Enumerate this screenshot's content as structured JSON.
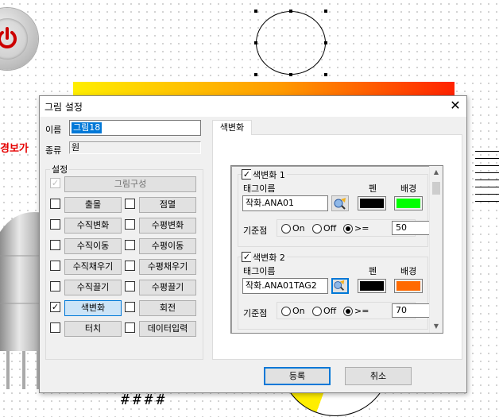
{
  "canvas": {
    "alarm_text": "경보가",
    "hash_text": "####"
  },
  "dialog": {
    "title": "그림 설정",
    "close_symbol": "✕",
    "name_label": "이름",
    "name_value": "그림18",
    "type_label": "종류",
    "type_value": "원",
    "settings_group_label": "설정",
    "settings": {
      "shape_config": "그림구성",
      "appear": "출몰",
      "blink": "점멸",
      "vertical_change": "수직변화",
      "horizontal_change": "수평변화",
      "vertical_move": "수직이동",
      "horizontal_move": "수평이동",
      "vertical_fill": "수직채우기",
      "horizontal_fill": "수평채우기",
      "vertical_drag": "수직끌기",
      "horizontal_drag": "수평끌기",
      "color_change": "색변화",
      "rotate": "회전",
      "touch": "터치",
      "data_input": "데이터입력"
    },
    "check_mark": "✓",
    "tab_label": "색변화",
    "entries": [
      {
        "title": "색변화 1",
        "tag_label": "태그이름",
        "tag_value": "작화.ANA01",
        "pen_label": "펜",
        "bg_label": "배경",
        "pen_color": "#000000",
        "bg_color": "#00ff00",
        "ref_label": "기준점",
        "radio_on": "On",
        "radio_off": "Off",
        "radio_ge": ">=",
        "ref_value": "50"
      },
      {
        "title": "색변화 2",
        "tag_label": "태그이름",
        "tag_value": "작화.ANA01TAG2",
        "pen_label": "펜",
        "bg_label": "배경",
        "pen_color": "#000000",
        "bg_color": "#ff6a00",
        "ref_label": "기준점",
        "radio_on": "On",
        "radio_off": "Off",
        "radio_ge": ">=",
        "ref_value": "70"
      }
    ],
    "ok_button": "등록",
    "cancel_button": "취소"
  }
}
